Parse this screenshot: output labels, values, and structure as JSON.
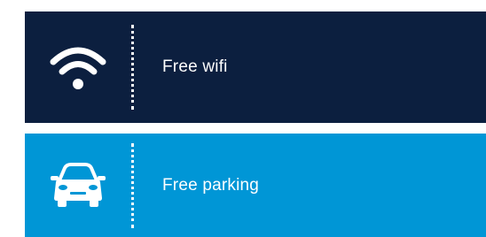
{
  "amenities": [
    {
      "label": "Free wifi",
      "icon": "wifi-icon",
      "background": "#0c1f3f"
    },
    {
      "label": "Free parking",
      "icon": "car-icon",
      "background": "#0096d6"
    }
  ],
  "colors": {
    "text": "#ffffff",
    "dark_navy": "#0c1f3f",
    "sky_blue": "#0096d6"
  }
}
